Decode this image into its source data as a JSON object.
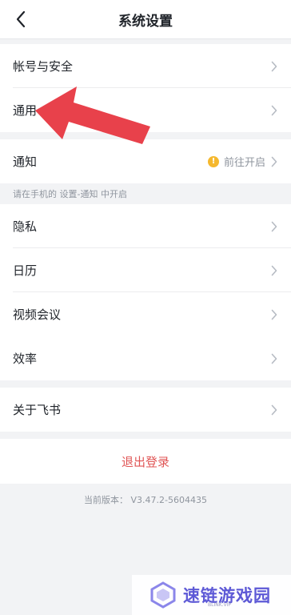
{
  "header": {
    "title": "系统设置"
  },
  "groups": {
    "account": {
      "items": [
        {
          "label": "帐号与安全"
        },
        {
          "label": "通用"
        }
      ]
    },
    "notify": {
      "label": "通知",
      "status_text": "前往开启",
      "hint": "请在手机的 设置-通知 中开启"
    },
    "features": {
      "items": [
        {
          "label": "隐私"
        },
        {
          "label": "日历"
        },
        {
          "label": "视频会议"
        },
        {
          "label": "效率"
        }
      ]
    },
    "about": {
      "label": "关于飞书"
    }
  },
  "logout": {
    "label": "退出登录"
  },
  "version": {
    "text": "当前版本： V3.47.2-5604435"
  },
  "watermark": {
    "text": "速链游戏园",
    "sub": "BLINK.VIP"
  },
  "colors": {
    "logout": "#e05656",
    "warning": "#f5b82e",
    "arrow": "#e8414b",
    "watermark": "#5d59d6"
  },
  "icons": {
    "back": "chevron-left-icon",
    "row": "chevron-right-icon",
    "warning": "warning-icon"
  }
}
